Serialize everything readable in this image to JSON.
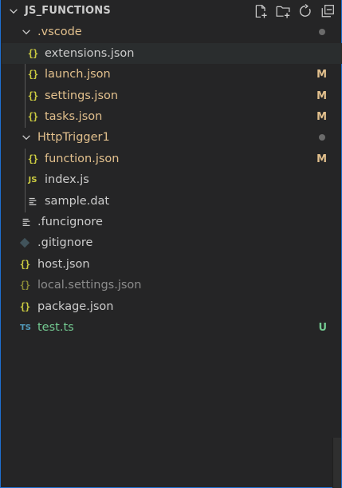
{
  "explorer": {
    "title": "JS_FUNCTIONS",
    "actions": [
      {
        "name": "new-file-icon",
        "label": "New File"
      },
      {
        "name": "new-folder-icon",
        "label": "New Folder"
      },
      {
        "name": "refresh-icon",
        "label": "Refresh Explorer"
      },
      {
        "name": "collapse-all-icon",
        "label": "Collapse Folders in Explorer"
      }
    ]
  },
  "tree": [
    {
      "label": ".vscode",
      "type": "folder",
      "expanded": true,
      "level": 1,
      "color": "#e2c08d",
      "status": "dot"
    },
    {
      "label": "extensions.json",
      "type": "json",
      "level": 2,
      "color": "#cccccc",
      "status": ""
    },
    {
      "label": "launch.json",
      "type": "json",
      "level": 2,
      "color": "#e2c08d",
      "status": "M"
    },
    {
      "label": "settings.json",
      "type": "json",
      "level": 2,
      "color": "#e2c08d",
      "status": "M"
    },
    {
      "label": "tasks.json",
      "type": "json",
      "level": 2,
      "color": "#e2c08d",
      "status": "M"
    },
    {
      "label": "HttpTrigger1",
      "type": "folder",
      "expanded": true,
      "level": 1,
      "color": "#e2c08d",
      "status": "dot"
    },
    {
      "label": "function.json",
      "type": "json",
      "level": 2,
      "color": "#e2c08d",
      "status": "M"
    },
    {
      "label": "index.js",
      "type": "js",
      "level": 2,
      "color": "#cccccc",
      "status": ""
    },
    {
      "label": "sample.dat",
      "type": "text",
      "level": 2,
      "color": "#cccccc",
      "status": ""
    },
    {
      "label": ".funcignore",
      "type": "text",
      "level": 1,
      "color": "#cccccc",
      "status": ""
    },
    {
      "label": ".gitignore",
      "type": "git",
      "level": 1,
      "color": "#cccccc",
      "status": ""
    },
    {
      "label": "host.json",
      "type": "json",
      "level": 1,
      "color": "#cccccc",
      "status": ""
    },
    {
      "label": "local.settings.json",
      "type": "json",
      "level": 1,
      "color": "#8c8c8c",
      "status": ""
    },
    {
      "label": "package.json",
      "type": "json",
      "level": 1,
      "color": "#cccccc",
      "status": ""
    },
    {
      "label": "test.ts",
      "type": "ts",
      "level": 1,
      "color": "#73c991",
      "status": "U"
    }
  ],
  "icons": {
    "json": "{}",
    "js": "JS",
    "ts": "TS"
  },
  "colors": {
    "modified": "#e2c08d",
    "untracked": "#73c991",
    "ignored": "#8c8c8c",
    "focus_border": "#1f6fd0"
  }
}
